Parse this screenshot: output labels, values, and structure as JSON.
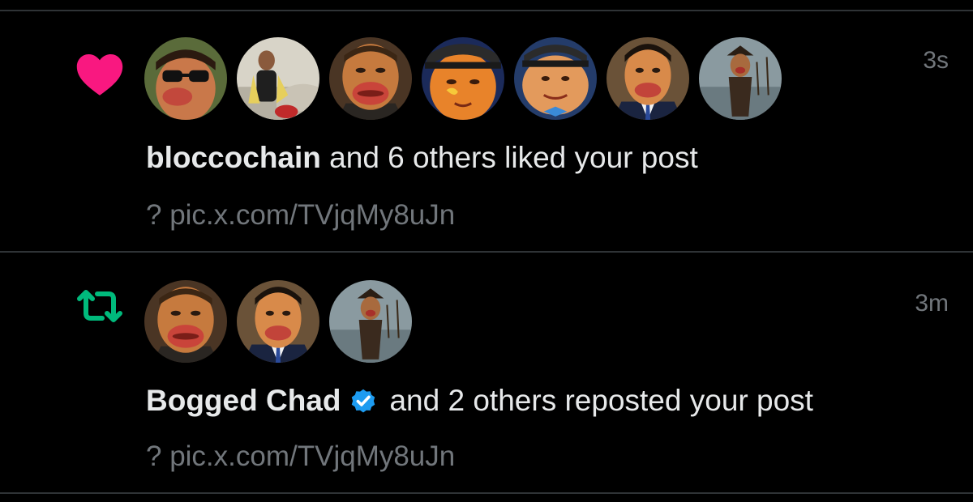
{
  "notifications": [
    {
      "type_icon": "heart-icon",
      "accent": "#f91880",
      "avatars": [
        {
          "name": "avatar-sunglasses"
        },
        {
          "name": "avatar-car"
        },
        {
          "name": "avatar-bogged"
        },
        {
          "name": "avatar-cap-flame"
        },
        {
          "name": "avatar-cap-bowtie"
        },
        {
          "name": "avatar-suit"
        },
        {
          "name": "avatar-pirate"
        }
      ],
      "time": "3s",
      "actor": "bloccochain",
      "action": " and 6 others liked your post",
      "preview": "? pic.x.com/TVjqMy8uJn"
    },
    {
      "type_icon": "repost-icon",
      "accent": "#00ba7c",
      "avatars": [
        {
          "name": "avatar-bogged"
        },
        {
          "name": "avatar-suit"
        },
        {
          "name": "avatar-pirate"
        }
      ],
      "time": "3m",
      "actor": "Bogged Chad",
      "verified_color": "#1d9bf0",
      "action": "and 2 others reposted your post",
      "preview": "? pic.x.com/TVjqMy8uJn"
    }
  ]
}
